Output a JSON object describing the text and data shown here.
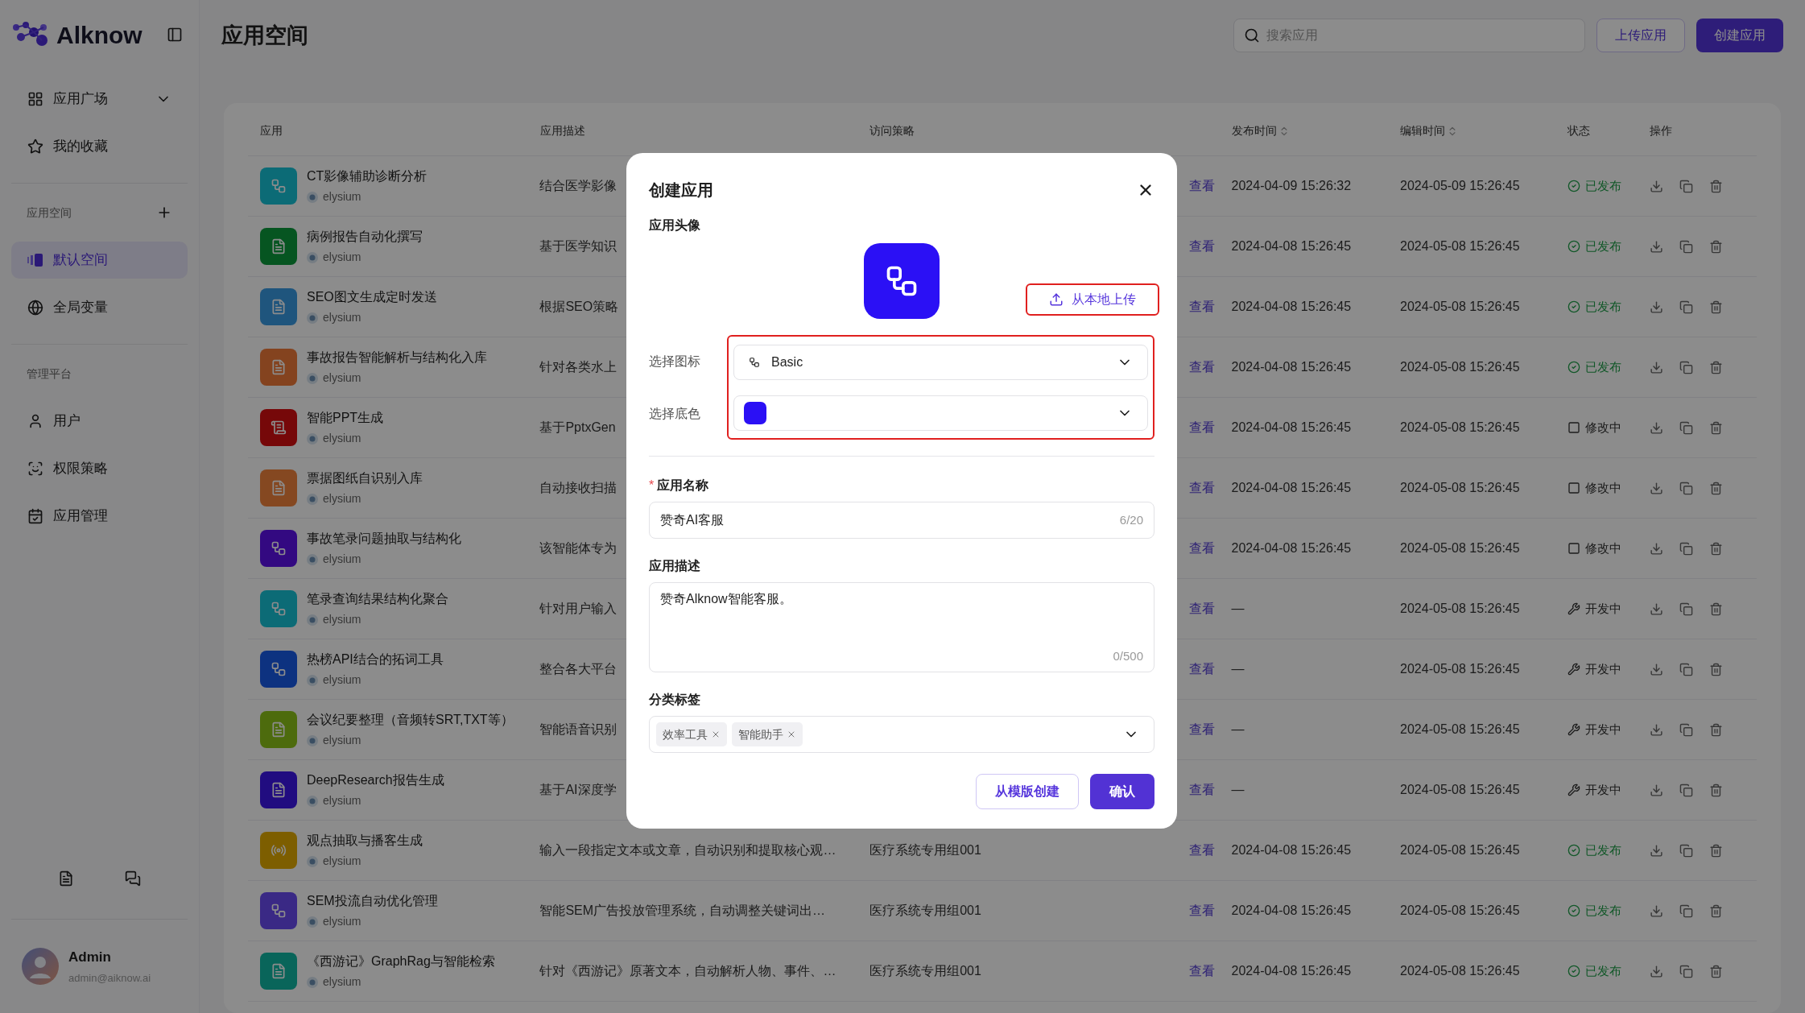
{
  "sidebar": {
    "logo": "Alknow",
    "top_items": [
      {
        "label": "应用广场",
        "selected": false
      },
      {
        "label": "我的收藏",
        "selected": false
      }
    ],
    "sections": [
      {
        "title": "应用空间",
        "items": [
          {
            "label": "默认空间",
            "selected": true
          },
          {
            "label": "全局变量",
            "selected": false
          }
        ]
      },
      {
        "title": "管理平台",
        "items": [
          {
            "label": "用户",
            "selected": false
          },
          {
            "label": "权限策略",
            "selected": false
          },
          {
            "label": "应用管理",
            "selected": false
          }
        ]
      }
    ],
    "user": {
      "name": "Admin",
      "email": "admin@aiknow.ai"
    }
  },
  "header": {
    "title": "应用空间",
    "search_placeholder": "搜索应用",
    "buttons": [
      {
        "label": "上传应用",
        "kind": "outline"
      },
      {
        "label": "创建应用",
        "kind": "primary"
      }
    ]
  },
  "table": {
    "columns": [
      {
        "label": "应用",
        "sortable": false
      },
      {
        "label": "应用描述",
        "sortable": false
      },
      {
        "label": "访问策略",
        "sortable": false
      },
      {
        "label": "发布时间",
        "sortable": true
      },
      {
        "label": "编辑时间",
        "sortable": true
      },
      {
        "label": "状态",
        "sortable": false
      },
      {
        "label": "操作",
        "sortable": false
      }
    ],
    "rows": [
      {
        "name": "CT影像辅助诊断分析",
        "owner": "elysium",
        "kind": "workflow",
        "color": "#0c6b77",
        "description": "结合医学影像",
        "action": "查看",
        "published": "2024-04-09 15:26:32",
        "edited": "2024-05-09 15:26:45",
        "status": {
          "kind": "published",
          "label": "已发布"
        }
      },
      {
        "name": "病例报告自动化撰写",
        "owner": "elysium",
        "kind": "document",
        "color": "#065621",
        "description": "基于医学知识",
        "action": "查看",
        "published": "2024-04-08 15:26:45",
        "edited": "2024-05-08 15:26:45",
        "status": {
          "kind": "published",
          "label": "已发布"
        }
      },
      {
        "name": "SEO图文生成定时发送",
        "owner": "elysium",
        "kind": "document",
        "color": "#20557d",
        "description": "根据SEO策略",
        "action": "查看",
        "published": "2024-04-08 15:26:45",
        "edited": "2024-05-08 15:26:45",
        "status": {
          "kind": "published",
          "label": "已发布"
        }
      },
      {
        "name": "事故报告智能解析与结构化入库",
        "owner": "elysium",
        "kind": "document",
        "color": "#844320",
        "description": "针对各类水上",
        "action": "查看",
        "published": "2024-04-08 15:26:45",
        "edited": "2024-05-08 15:26:45",
        "status": {
          "kind": "published",
          "label": "已发布"
        }
      },
      {
        "name": "智能PPT生成",
        "owner": "elysium",
        "kind": "slides",
        "color": "#77080a",
        "description": "基于PptxGen",
        "action": "查看",
        "published": "2024-04-08 15:26:45",
        "edited": "2024-05-08 15:26:45",
        "status": {
          "kind": "editing",
          "label": "修改中"
        }
      },
      {
        "name": "票据图纸自识别入库",
        "owner": "elysium",
        "kind": "document",
        "color": "#854821",
        "description": "自动接收扫描",
        "action": "查看",
        "published": "2024-04-08 15:26:45",
        "edited": "2024-05-08 15:26:45",
        "status": {
          "kind": "editing",
          "label": "修改中"
        }
      },
      {
        "name": "事故笔录问题抽取与结构化",
        "owner": "elysium",
        "kind": "workflow",
        "color": "#330a81",
        "description": "该智能体专为",
        "action": "查看",
        "published": "2024-04-08 15:26:45",
        "edited": "2024-05-08 15:26:45",
        "status": {
          "kind": "editing",
          "label": "修改中"
        }
      },
      {
        "name": "笔录查询结果结构化聚合",
        "owner": "elysium",
        "kind": "workflow",
        "color": "#0c6b77",
        "description": "针对用户输入",
        "action": "查看",
        "published": "—",
        "edited": "2024-05-08 15:26:45",
        "status": {
          "kind": "developing",
          "label": "开发中"
        }
      },
      {
        "name": "热榜API结合的拓词工具",
        "owner": "elysium",
        "kind": "workflow",
        "color": "#0e3280",
        "description": "整合各大平台",
        "action": "查看",
        "published": "—",
        "edited": "2024-05-08 15:26:45",
        "status": {
          "kind": "developing",
          "label": "开发中"
        }
      },
      {
        "name": "会议纪要整理（音频转SRT,TXT等）",
        "owner": "elysium",
        "kind": "document",
        "color": "#4d6b0e",
        "description": "智能语音识别",
        "action": "查看",
        "published": "—",
        "edited": "2024-05-08 15:26:45",
        "status": {
          "kind": "developing",
          "label": "开发中"
        }
      },
      {
        "name": "DeepResearch报告生成",
        "owner": "elysium",
        "kind": "document",
        "color": "#210c80",
        "description": "基于AI深度学",
        "action": "查看",
        "published": "—",
        "edited": "2024-05-08 15:26:45",
        "status": {
          "kind": "developing",
          "label": "开发中"
        }
      },
      {
        "name": "观点抽取与播客生成",
        "owner": "elysium",
        "kind": "audio",
        "color": "#7d5e00",
        "description": "输入一段指定文本或文章，自动识别和提取核心观…",
        "policy": "医疗系统专用组001",
        "action": "查看",
        "published": "2024-04-08 15:26:45",
        "edited": "2024-05-08 15:26:45",
        "status": {
          "kind": "published",
          "label": "已发布"
        }
      },
      {
        "name": "SEM投流自动优化管理",
        "owner": "elysium",
        "kind": "workflow",
        "color": "#3b2985",
        "description": "智能SEM广告投放管理系统，自动调整关键词出…",
        "policy": "医疗系统专用组001",
        "action": "查看",
        "published": "2024-04-08 15:26:45",
        "edited": "2024-05-08 15:26:45",
        "status": {
          "kind": "published",
          "label": "已发布"
        }
      },
      {
        "name": "《西游记》GraphRag与智能检索",
        "owner": "elysium",
        "kind": "document",
        "color": "#0a655a",
        "description": "针对《西游记》原著文本，自动解析人物、事件、…",
        "policy": "医疗系统专用组001",
        "action": "查看",
        "published": "2024-04-08 15:26:45",
        "edited": "2024-05-08 15:26:45",
        "status": {
          "kind": "published",
          "label": "已发布"
        }
      }
    ]
  },
  "modal": {
    "title": "创建应用",
    "avatar_label": "应用头像",
    "avatar": {
      "color": "#2b10f5"
    },
    "upload_button": {
      "label": "从本地上传",
      "highlighted": true
    },
    "selectors_highlighted": true,
    "icon_select": {
      "label": "选择图标",
      "value": "Basic"
    },
    "color_select": {
      "label": "选择底色",
      "color": "#2b10f5"
    },
    "name_field": {
      "label": "应用名称",
      "required_mark": "*",
      "value": "赞奇AI客服",
      "count": "6/20"
    },
    "description_field": {
      "label": "应用描述",
      "value": "赞奇Alknow智能客服。",
      "count": "0/500"
    },
    "tags_field": {
      "label": "分类标签",
      "tags": [
        "效率工具",
        "智能助手"
      ]
    },
    "buttons": [
      {
        "label": "从模版创建",
        "kind": "outline"
      },
      {
        "label": "确认",
        "kind": "primary"
      }
    ]
  }
}
